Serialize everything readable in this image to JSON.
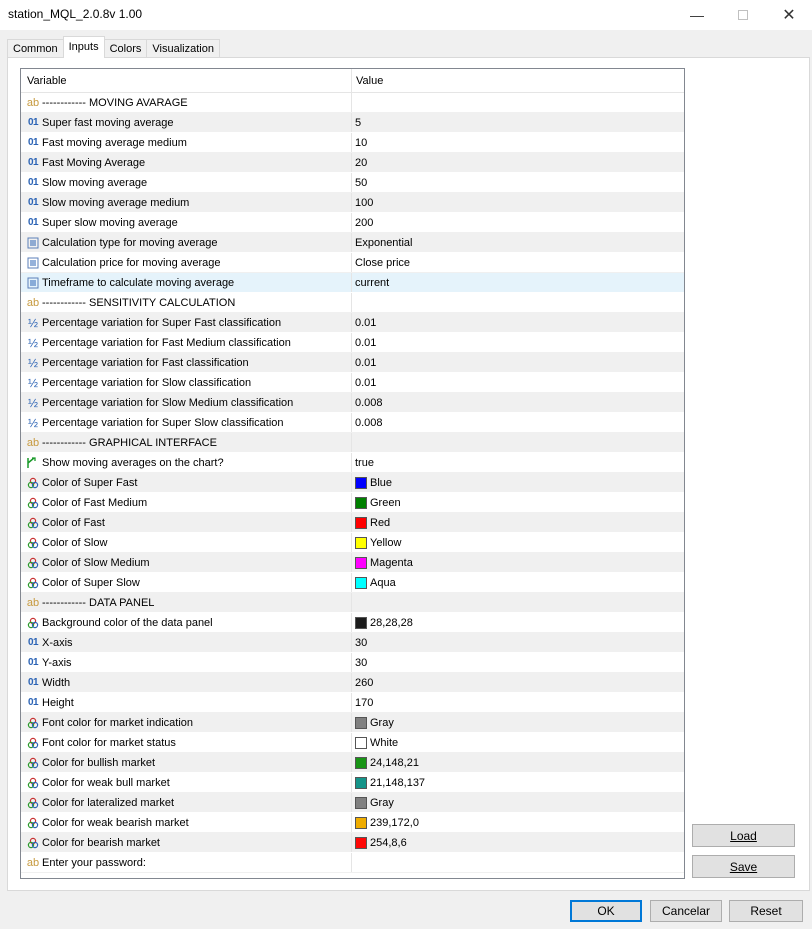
{
  "window": {
    "title": "station_MQL_2.0.8v 1.00"
  },
  "tabs": [
    "Common",
    "Inputs",
    "Colors",
    "Visualization"
  ],
  "active_tab": "Inputs",
  "grid": {
    "headers": {
      "variable": "Variable",
      "value": "Value"
    },
    "rows": [
      {
        "type": "string",
        "name": "------------ MOVING AVARAGE",
        "value": ""
      },
      {
        "type": "int",
        "name": "Super fast moving average",
        "value": "5"
      },
      {
        "type": "int",
        "name": "Fast moving average medium",
        "value": "10"
      },
      {
        "type": "int",
        "name": "Fast Moving Average",
        "value": "20"
      },
      {
        "type": "int",
        "name": "Slow moving average",
        "value": "50"
      },
      {
        "type": "int",
        "name": "Slow moving average medium",
        "value": "100"
      },
      {
        "type": "int",
        "name": "Super slow moving average",
        "value": "200"
      },
      {
        "type": "enum",
        "name": "Calculation type for moving average",
        "value": "Exponential"
      },
      {
        "type": "enum",
        "name": "Calculation price for moving average",
        "value": "Close price"
      },
      {
        "type": "enum",
        "name": "Timeframe to calculate moving average",
        "value": "current",
        "selected": true
      },
      {
        "type": "string",
        "name": "------------ SENSITIVITY CALCULATION",
        "value": ""
      },
      {
        "type": "double",
        "name": "Percentage variation for Super Fast classification",
        "value": "0.01"
      },
      {
        "type": "double",
        "name": "Percentage variation for Fast Medium classification",
        "value": "0.01"
      },
      {
        "type": "double",
        "name": "Percentage variation for Fast classification",
        "value": "0.01"
      },
      {
        "type": "double",
        "name": "Percentage variation for Slow classification",
        "value": "0.01"
      },
      {
        "type": "double",
        "name": "Percentage variation for Slow Medium classification",
        "value": "0.008"
      },
      {
        "type": "double",
        "name": "Percentage variation for Super Slow classification",
        "value": "0.008"
      },
      {
        "type": "string",
        "name": "------------ GRAPHICAL INTERFACE",
        "value": ""
      },
      {
        "type": "bool",
        "name": "Show moving averages on the chart?",
        "value": "true"
      },
      {
        "type": "color",
        "name": "Color of Super Fast",
        "value": "Blue",
        "color": "#0000ff"
      },
      {
        "type": "color",
        "name": "Color of Fast Medium",
        "value": "Green",
        "color": "#008000"
      },
      {
        "type": "color",
        "name": "Color of Fast",
        "value": "Red",
        "color": "#ff0000"
      },
      {
        "type": "color",
        "name": "Color of Slow",
        "value": "Yellow",
        "color": "#ffff00"
      },
      {
        "type": "color",
        "name": "Color of Slow Medium",
        "value": "Magenta",
        "color": "#ff00ff"
      },
      {
        "type": "color",
        "name": "Color of Super Slow",
        "value": "Aqua",
        "color": "#00ffff"
      },
      {
        "type": "string",
        "name": "------------ DATA PANEL",
        "value": ""
      },
      {
        "type": "color",
        "name": "Background color of the data panel",
        "value": "28,28,28",
        "color": "#1c1c1c"
      },
      {
        "type": "int",
        "name": "X-axis",
        "value": "30"
      },
      {
        "type": "int",
        "name": "Y-axis",
        "value": "30"
      },
      {
        "type": "int",
        "name": "Width",
        "value": "260"
      },
      {
        "type": "int",
        "name": "Height",
        "value": "170"
      },
      {
        "type": "color",
        "name": "Font color for market indication",
        "value": "Gray",
        "color": "#808080"
      },
      {
        "type": "color",
        "name": "Font color for market status",
        "value": "White",
        "color": "#ffffff"
      },
      {
        "type": "color",
        "name": "Color for bullish market",
        "value": "24,148,21",
        "color": "#189415"
      },
      {
        "type": "color",
        "name": "Color for weak bull market",
        "value": "21,148,137",
        "color": "#159489"
      },
      {
        "type": "color",
        "name": "Color for lateralized market",
        "value": "Gray",
        "color": "#808080"
      },
      {
        "type": "color",
        "name": "Color for weak bearish market",
        "value": "239,172,0",
        "color": "#efac00"
      },
      {
        "type": "color",
        "name": "Color for bearish market",
        "value": "254,8,6",
        "color": "#fe0806"
      },
      {
        "type": "string",
        "name": "Enter your password:",
        "value": ""
      }
    ]
  },
  "side_buttons": {
    "load": "Load",
    "save": "Save"
  },
  "dialog_buttons": {
    "ok": "OK",
    "cancel": "Cancelar",
    "reset": "Reset"
  }
}
